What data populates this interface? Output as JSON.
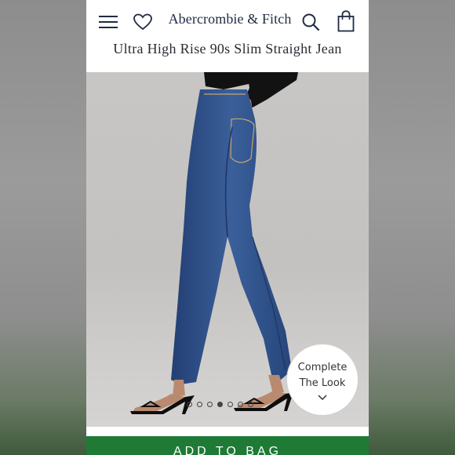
{
  "header": {
    "logo_text": "Abercrombie & Fitch",
    "icons": [
      "menu-icon",
      "heart-icon",
      "search-icon",
      "shopping-bag-icon"
    ]
  },
  "product": {
    "title": "Ultra High Rise 90s Slim Straight Jean"
  },
  "gallery": {
    "total_images": 7,
    "active_index": 3
  },
  "complete_the_look": {
    "line1": "Complete",
    "line2": "The Look"
  },
  "add_to_bag": {
    "label": "ADD TO BAG"
  },
  "colors": {
    "brand_navy": "#1f2a44",
    "add_button_green": "#1e7a35",
    "denim": "#2f4f86"
  }
}
